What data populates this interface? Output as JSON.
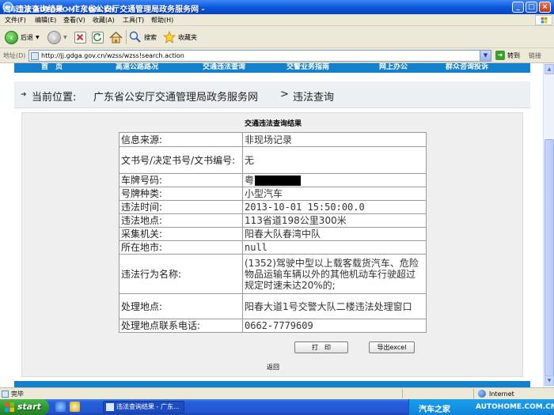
{
  "window": {
    "title": "违法查询结果 - 广东省公安厅交通管理局政务服务网 -",
    "watermark": "汽车之家 AUTOHOME.COM.CN",
    "controls": [
      "_",
      "□",
      "×"
    ]
  },
  "menu": {
    "items": [
      "文件(F)",
      "编辑(E)",
      "查看(V)",
      "收藏(A)",
      "工具(T)",
      "帮助(H)"
    ]
  },
  "toolbar": {
    "back_label": "后退",
    "search_label": "搜索",
    "favorites_label": "收藏夹"
  },
  "address": {
    "label": "地址(D)",
    "url": "http://jj.gdga.gov.cn/wzss/wzss!search.action",
    "go_label": "转到",
    "links_label": "链接"
  },
  "site": {
    "nav": [
      "首　页",
      "高速公路路况",
      "交通违法查询",
      "交警业务指南",
      "网上办公",
      "群众咨询投诉"
    ],
    "breadcrumb": {
      "prefix": "当前位置:",
      "home": "广东省公安厅交通管理局政务服务网",
      "separator": ">",
      "current": "违法查询"
    }
  },
  "result": {
    "caption": "交通违法查询结果",
    "rows": [
      {
        "key": "信息来源:",
        "value": "非现场记录"
      },
      {
        "key": "文书号/决定书号/文书编号:",
        "value": "无"
      },
      {
        "key": "车牌号码:",
        "value": "粤"
      },
      {
        "key": "号牌种类:",
        "value": "小型汽车"
      },
      {
        "key": "违法时间:",
        "value": "2013-10-01 15:50:00.0"
      },
      {
        "key": "违法地点:",
        "value": "113省道198公里300米"
      },
      {
        "key": "采集机关:",
        "value": "阳春大队春湾中队"
      },
      {
        "key": "所在地市:",
        "value": "null"
      },
      {
        "key": "违法行为名称:",
        "value": "(1352)驾驶中型以上载客载货汽车、危险物品运输车辆以外的其他机动车行驶超过规定时速未达20%的;"
      },
      {
        "key": "处理地点:",
        "value": "阳春大道1号交警大队二楼违法处理窗口"
      },
      {
        "key": "处理地点联系电话:",
        "value": "0662-7779609"
      }
    ],
    "print_label": "打　印",
    "export_label": "导出excel",
    "back_label": "返回"
  },
  "status": {
    "text": "完毕",
    "zone": "Internet"
  },
  "taskbar": {
    "start_label": "start",
    "task_label": "违法查询结果 - 广东...",
    "brand_cn": "汽车之家",
    "brand_en": "AUTOHOME.COM.CN"
  },
  "colors": {
    "nav_blue": "#1580cc",
    "xp_title_blue": "#0a55d8",
    "xp_start_green": "#2f9a2f"
  }
}
